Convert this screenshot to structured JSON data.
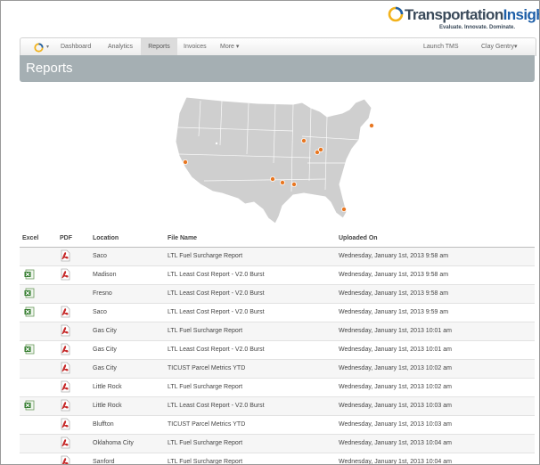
{
  "brand": {
    "name_part1": "Transportation",
    "name_part2": "Insight",
    "tagline": "Evaluate. Innovate. Dominate.",
    "colors": {
      "ring_outer": "#f2b21b",
      "ring_inner": "#1e5fa8",
      "text": "#3a4a5a"
    }
  },
  "nav": {
    "home_icon": "app-logo-icon",
    "items": [
      {
        "label": "Dashboard"
      },
      {
        "label": "Analytics"
      },
      {
        "label": "Reports",
        "active": true
      },
      {
        "label": "Invoices"
      },
      {
        "label": "More ▾"
      }
    ],
    "right": [
      {
        "label": "Launch TMS"
      },
      {
        "label": "Clay Gentry▾"
      }
    ]
  },
  "header": {
    "title": "Reports",
    "color": "#a5afb3"
  },
  "map": {
    "description_icon": "us-map",
    "marker_color": "#e87722"
  },
  "table": {
    "columns": [
      "Excel",
      "PDF",
      "Location",
      "File Name",
      "Uploaded On"
    ],
    "rows": [
      {
        "excel": false,
        "pdf": true,
        "location": "Saco",
        "file": "LTL Fuel Surcharge Report",
        "uploaded": "Wednesday, January 1st, 2013 9:58 am"
      },
      {
        "excel": true,
        "pdf": true,
        "location": "Madison",
        "file": "LTL Least Cost Report - V2.0 Burst",
        "uploaded": "Wednesday, January 1st, 2013 9:58 am"
      },
      {
        "excel": true,
        "pdf": false,
        "location": "Fresno",
        "file": "LTL Least Cost Report - V2.0 Burst",
        "uploaded": "Wednesday, January 1st, 2013 9:58 am"
      },
      {
        "excel": true,
        "pdf": true,
        "location": "Saco",
        "file": "LTL Least Cost Report - V2.0 Burst",
        "uploaded": "Wednesday, January 1st, 2013 9:59 am"
      },
      {
        "excel": false,
        "pdf": true,
        "location": "Gas City",
        "file": "LTL Fuel Surcharge Report",
        "uploaded": "Wednesday, January 1st, 2013 10:01 am"
      },
      {
        "excel": true,
        "pdf": true,
        "location": "Gas City",
        "file": "LTL Least Cost Report - V2.0 Burst",
        "uploaded": "Wednesday, January 1st, 2013 10:01 am"
      },
      {
        "excel": false,
        "pdf": true,
        "location": "Gas City",
        "file": "TICUST Parcel Metrics YTD",
        "uploaded": "Wednesday, January 1st, 2013 10:02 am"
      },
      {
        "excel": false,
        "pdf": true,
        "location": "Little Rock",
        "file": "LTL Fuel Surcharge Report",
        "uploaded": "Wednesday, January 1st, 2013 10:02 am"
      },
      {
        "excel": true,
        "pdf": true,
        "location": "Little Rock",
        "file": "LTL Least Cost Report - V2.0 Burst",
        "uploaded": "Wednesday, January 1st, 2013 10:03 am"
      },
      {
        "excel": false,
        "pdf": true,
        "location": "Bluffton",
        "file": "TICUST Parcel Metrics YTD",
        "uploaded": "Wednesday, January 1st, 2013 10:03 am"
      },
      {
        "excel": false,
        "pdf": true,
        "location": "Oklahoma City",
        "file": "LTL Fuel Surcharge Report",
        "uploaded": "Wednesday, January 1st, 2013 10:04 am"
      },
      {
        "excel": false,
        "pdf": true,
        "location": "Sanford",
        "file": "LTL Fuel Surcharge Report",
        "uploaded": "Wednesday, January 1st, 2013 10:04 am"
      }
    ]
  },
  "icons": {
    "excel": "excel-file-icon",
    "pdf": "pdf-file-icon"
  }
}
